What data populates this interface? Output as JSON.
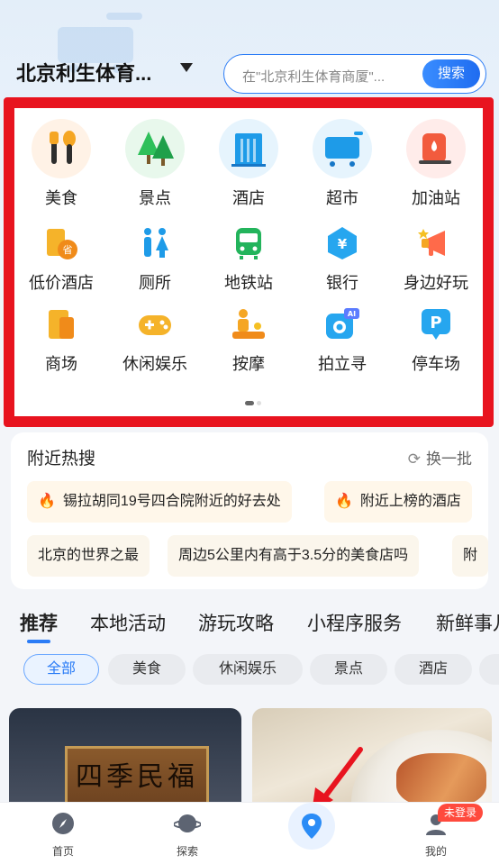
{
  "header": {
    "city": "北京利生体育...",
    "search_placeholder": "在\"北京利生体育商厦\"...",
    "search_button": "搜索"
  },
  "categories_row1": [
    "美食",
    "景点",
    "酒店",
    "超市",
    "加油站"
  ],
  "categories_row2": [
    "低价酒店",
    "厕所",
    "地铁站",
    "银行",
    "身边好玩"
  ],
  "categories_row3": [
    "商场",
    "休闲娱乐",
    "按摩",
    "拍立寻",
    "停车场"
  ],
  "hot": {
    "title": "附近热搜",
    "refresh": "换一批",
    "chips": [
      "锡拉胡同19号四合院附近的好去处",
      "附近上榜的酒店",
      "北京的世界之最",
      "周边5公里内有高于3.5分的美食店吗",
      "附"
    ]
  },
  "tabs": [
    "推荐",
    "本地活动",
    "游玩攻略",
    "小程序服务",
    "新鲜事儿"
  ],
  "filters": [
    "全部",
    "美食",
    "休闲娱乐",
    "景点",
    "酒店"
  ],
  "feed": {
    "sign_text": "四季民福"
  },
  "nav": {
    "home": "首页",
    "explore": "探索",
    "mine": "我的",
    "badge": "未登录"
  },
  "colors": {
    "accent": "#2b7cf6",
    "highlight_border": "#e8141f",
    "badge": "#ff4a3d"
  }
}
